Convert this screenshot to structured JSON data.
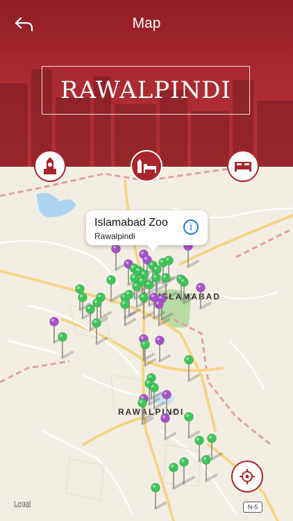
{
  "header": {
    "title": "Map",
    "city": "RAWALPINDI",
    "back_icon": "back-arrow-icon",
    "accent_color": "#a8262b"
  },
  "categories": [
    {
      "icon": "clock-tower-icon",
      "active": false
    },
    {
      "icon": "city-hotel-icon",
      "active": true
    },
    {
      "icon": "bed-icon",
      "active": false
    }
  ],
  "map": {
    "labels": {
      "islamabad": "ISLAMABAD",
      "rawalpindi": "RAWALPINDI",
      "road_shield": "N-5",
      "legal": "Legal"
    },
    "callout": {
      "title": "Islamabad Zoo",
      "subtitle": "Rawalpindi",
      "info_icon": "info-icon"
    },
    "pin_colors": {
      "green": "#3fc45a",
      "purple": "#a552c8"
    },
    "locate_icon": "crosshair-icon"
  }
}
